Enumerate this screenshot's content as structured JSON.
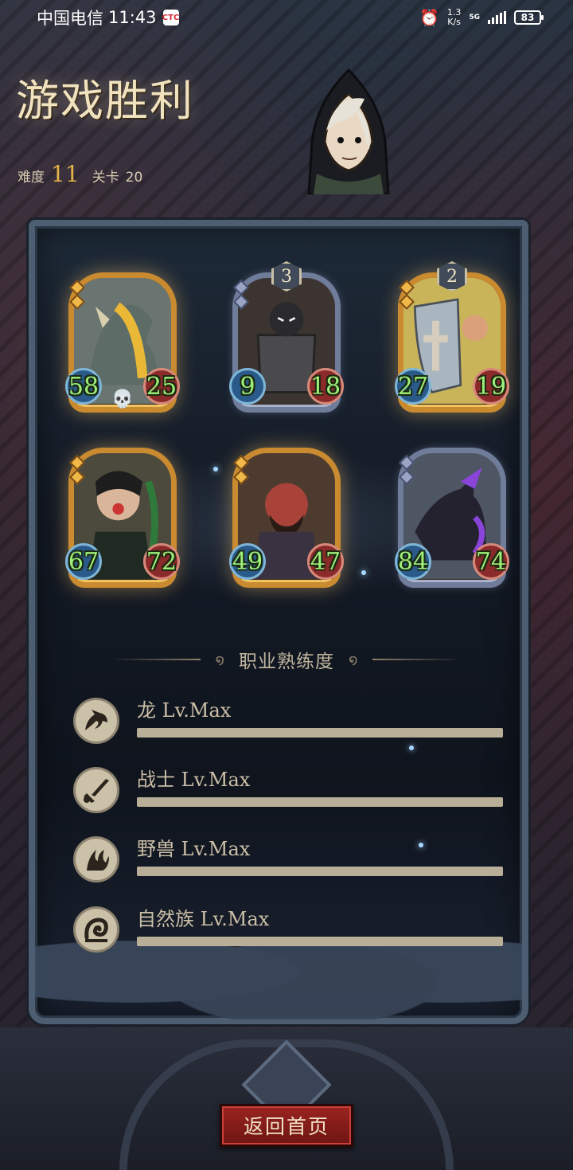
{
  "status_bar": {
    "carrier": "中国电信",
    "time": "11:43",
    "app_badge": "CTC",
    "net_speed_value": "1.3",
    "net_speed_unit": "K/s",
    "network": "5G",
    "battery": "83"
  },
  "header": {
    "title": "游戏胜利",
    "difficulty_label": "难度",
    "difficulty_value": "11",
    "stage_label": "关卡",
    "stage_value": "20"
  },
  "cards": [
    {
      "name": "dragon-gold",
      "frame": "gold",
      "atk": "58",
      "hp": "25",
      "badge": "",
      "skull": true
    },
    {
      "name": "shield-knight",
      "frame": "silver",
      "atk": "9",
      "hp": "18",
      "badge": "3",
      "skull": false
    },
    {
      "name": "crusader",
      "frame": "gold",
      "atk": "27",
      "hp": "19",
      "badge": "2",
      "skull": false
    },
    {
      "name": "goblin-shaman",
      "frame": "gold",
      "atk": "67",
      "hp": "72",
      "badge": "",
      "skull": false
    },
    {
      "name": "ogre-brute",
      "frame": "gold",
      "atk": "49",
      "hp": "47",
      "badge": "",
      "skull": false
    },
    {
      "name": "shadow-dragon",
      "frame": "silver",
      "atk": "84",
      "hp": "74",
      "badge": "",
      "skull": false
    }
  ],
  "mastery": {
    "title": "职业熟练度",
    "items": [
      {
        "label": "龙 Lv.Max",
        "icon": "dragon-icon",
        "progress": 1.0
      },
      {
        "label": "战士 Lv.Max",
        "icon": "sword-icon",
        "progress": 1.0
      },
      {
        "label": "野兽 Lv.Max",
        "icon": "beast-claw-icon",
        "progress": 1.0
      },
      {
        "label": "自然族 Lv.Max",
        "icon": "nature-swirl-icon",
        "progress": 1.0
      }
    ]
  },
  "footer": {
    "home_button": "返回首页"
  },
  "colors": {
    "gold_frame": "#c98a30",
    "silver_frame": "#6f7c9a",
    "button_red": "#9a2420",
    "stat_green": "#9ff07a"
  }
}
